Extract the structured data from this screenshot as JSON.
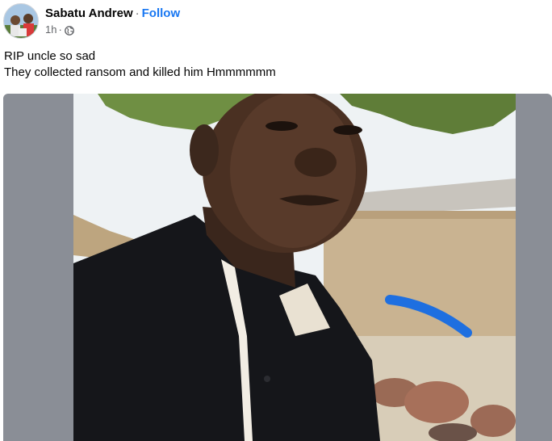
{
  "post": {
    "author": "Sabatu Andrew",
    "separator": "·",
    "follow_label": "Follow",
    "time": "1h",
    "time_separator": "·",
    "audience_icon": "globe-icon",
    "text_lines": [
      "RIP uncle so sad",
      "They collected ransom and killed him Hmmmmmm"
    ]
  },
  "photo": {
    "description_icon": "photo"
  },
  "colors": {
    "link": "#1877f2",
    "text_primary": "#050505",
    "text_secondary": "#65676b",
    "photo_frame": "#8a8e96",
    "marker_stroke": "#1e6fe0"
  }
}
